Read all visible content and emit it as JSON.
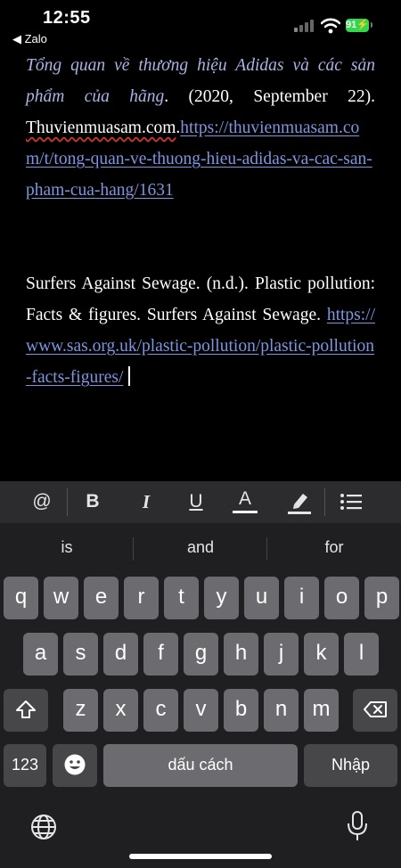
{
  "status": {
    "time": "12:55",
    "back_label": "◀ Zalo",
    "battery": "91"
  },
  "document": {
    "ref1_title": "Tổng quan về thương hiệu Adidas và các sản phẩm của hãng",
    "ref1_date": ". (2020, September 22).",
    "ref1_site": "Thuvienmuasam.com",
    "ref1_dot": ".",
    "ref1_url": "https://thuvienmuasam.com/t/tong-quan-ve-thuong-hieu-adidas-va-cac-san-pham-cua-hang/1631",
    "ref2_text": "Surfers Against Sewage. (n.d.). Plastic pollution: Facts & figures. Surfers Against Sewage.",
    "ref2_url": "https://www.sas.org.uk/plastic-pollution/plastic-pollution-facts-figures/"
  },
  "format_toolbar": {
    "mention": "@",
    "bold": "B",
    "italic": "I",
    "underline": "U",
    "text_color": "A"
  },
  "keyboard": {
    "suggestions": [
      "is",
      "and",
      "for"
    ],
    "row1": [
      "q",
      "w",
      "e",
      "r",
      "t",
      "y",
      "u",
      "i",
      "o",
      "p"
    ],
    "row2": [
      "a",
      "s",
      "d",
      "f",
      "g",
      "h",
      "j",
      "k",
      "l"
    ],
    "row3": [
      "z",
      "x",
      "c",
      "v",
      "b",
      "n",
      "m"
    ],
    "numbers_label": "123",
    "space_label": "dấu cách",
    "return_label": "Nhập"
  }
}
